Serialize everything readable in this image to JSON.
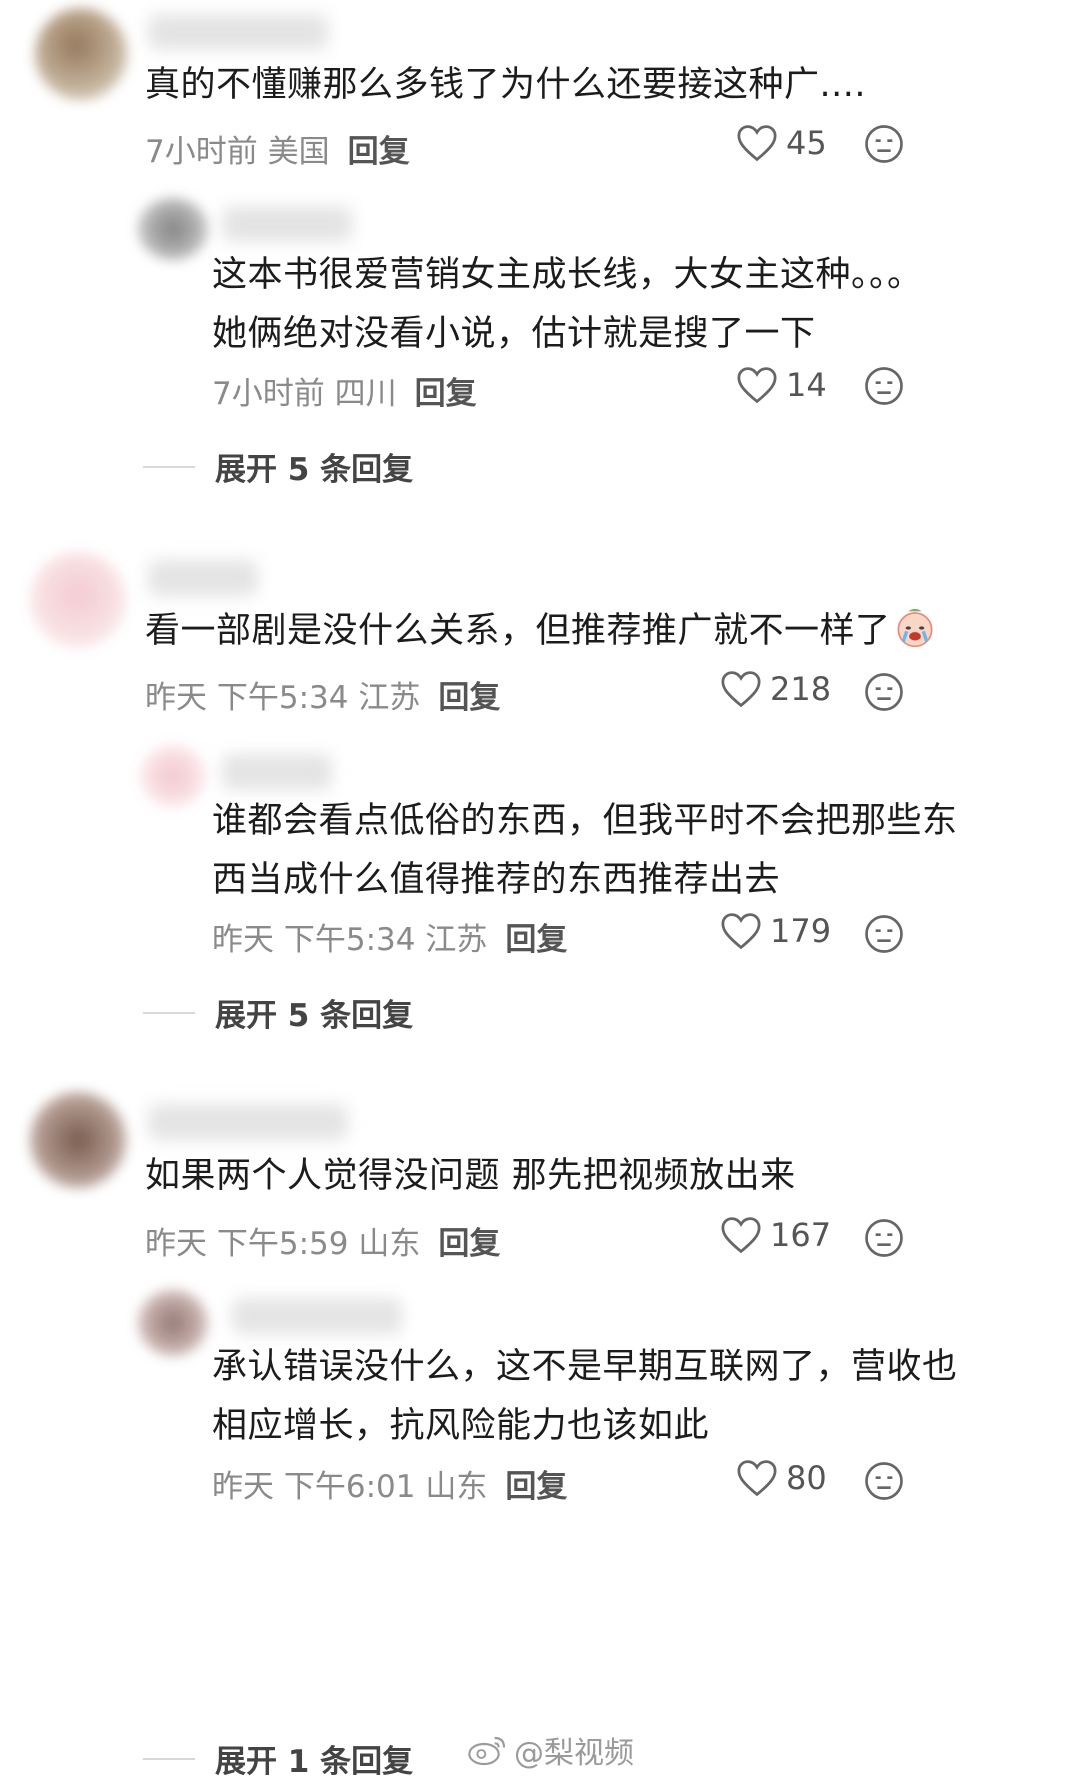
{
  "comments": [
    {
      "text": [
        "真的不懂赚那么多钱了为什么还要接这种广...."
      ],
      "meta": "7小时前 美国",
      "reply_label": "回复",
      "likes": "45"
    },
    {
      "text": [
        "这本书很爱营销女主成长线，大女主这种。。。",
        "她俩绝对没看小说，估计就是搜了一下"
      ],
      "meta": "7小时前 四川",
      "reply_label": "回复",
      "likes": "14"
    },
    {
      "text": [
        "看一部剧是没什么关系，但推荐推广就不一样了"
      ],
      "meta": "昨天 下午5:34 江苏",
      "reply_label": "回复",
      "likes": "218"
    },
    {
      "text": [
        "谁都会看点低俗的东西，但我平时不会把那些东",
        "西当成什么值得推荐的东西推荐出去"
      ],
      "meta": "昨天 下午5:34 江苏",
      "reply_label": "回复",
      "likes": "179"
    },
    {
      "text": [
        "如果两个人觉得没问题 那先把视频放出来"
      ],
      "meta": "昨天 下午5:59 山东",
      "reply_label": "回复",
      "likes": "167"
    },
    {
      "text": [
        "承认错误没什么，这不是早期互联网了，营收也",
        "相应增长，抗风险能力也该如此"
      ],
      "meta": "昨天 下午6:01 山东",
      "reply_label": "回复",
      "likes": "80"
    }
  ],
  "expand_links": [
    "展开 5 条回复",
    "展开 5 条回复",
    "展开 1 条回复"
  ],
  "watermark": "@梨视频",
  "icons": {
    "like": "heart-outline-icon",
    "dislike": "meh-face-icon",
    "emoji": "crying-laughing-face-emoji"
  },
  "colors": {
    "text": "#1c1c1c",
    "meta": "#8a8a8a",
    "reply": "#555555",
    "background": "#ffffff"
  }
}
